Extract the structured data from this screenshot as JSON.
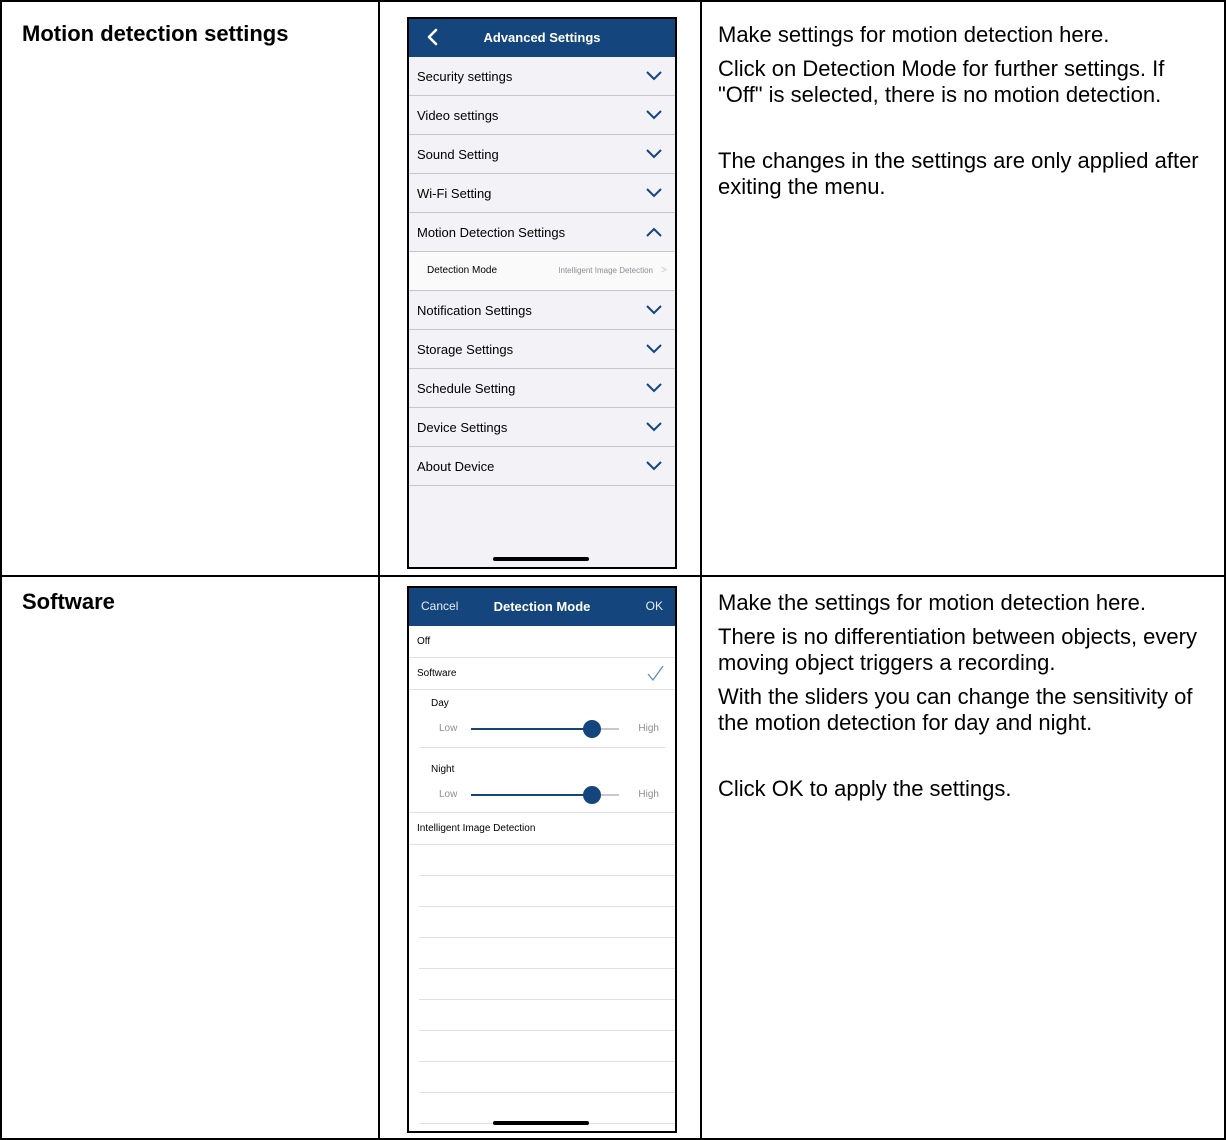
{
  "row1": {
    "title": "Motion detection settings",
    "paragraphs": [
      "Make settings for motion detection here.",
      "Click on Detection Mode for further settings. If \"Off\" is selected, there is no motion detection.",
      "The changes in the settings are only applied after exiting the menu."
    ],
    "phone": {
      "nav_title": "Advanced Settings",
      "items": [
        "Security settings",
        "Video settings",
        "Sound Setting",
        "Wi-Fi Setting",
        "Motion Detection Settings"
      ],
      "sub_item": {
        "label": "Detection Mode",
        "value": "Intelligent Image Detection"
      },
      "items_after": [
        "Notification Settings",
        "Storage Settings",
        "Schedule Setting",
        "Device Settings",
        "About Device"
      ]
    }
  },
  "row2": {
    "title": "Software",
    "paragraphs": [
      "Make the settings for motion detection here.",
      "There is no differentiation between objects, every moving object triggers a recording.",
      "With the sliders you can change the sensitivity of the motion detection for day and night.",
      "Click OK to apply the settings."
    ],
    "phone": {
      "cancel": "Cancel",
      "nav_title": "Detection Mode",
      "ok": "OK",
      "options": [
        "Off",
        "Software",
        "Intelligent Image Detection"
      ],
      "selected": "Software",
      "day_label": "Day",
      "night_label": "Night",
      "low": "Low",
      "high": "High",
      "day_level": 0.82,
      "night_level": 0.82
    }
  },
  "colors": {
    "nav": "#14457c",
    "slider": "#14457c"
  }
}
